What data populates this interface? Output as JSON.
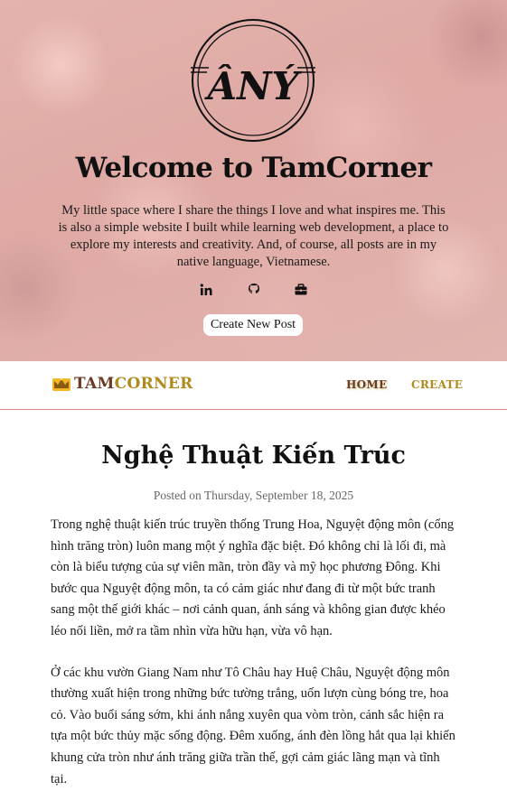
{
  "hero": {
    "logo_text": "ÂNÝ",
    "title": "Welcome to TamCorner",
    "description": "My little space where I share the things I love and what inspires me. This is also a simple website I built while learning web development, a place to explore my interests and creativity. And, of course, all posts are in my native language, Vietnamese.",
    "socials": [
      {
        "icon": "linkedin-icon"
      },
      {
        "icon": "github-icon"
      },
      {
        "icon": "briefcase-icon"
      }
    ],
    "create_button": "Create New Post"
  },
  "nav": {
    "brand_icon": "crown-icon",
    "brand_part1": "TAM",
    "brand_part2": "CORNER",
    "links": [
      {
        "label": "HOME"
      },
      {
        "label": "CREATE"
      }
    ]
  },
  "post": {
    "title": "Nghệ Thuật Kiến Trúc",
    "meta": "Posted on Thursday, September 18, 2025",
    "paragraphs": [
      "Trong nghệ thuật kiến trúc truyền thống Trung Hoa, Nguyệt động môn (cổng hình trăng tròn) luôn mang một ý nghĩa đặc biệt. Đó không chỉ là lối đi, mà còn là biểu tượng của sự viên mãn, tròn đầy và mỹ học phương Đông. Khi bước qua Nguyệt động môn, ta có cảm giác như đang đi từ một bức tranh sang một thế giới khác – nơi cảnh quan, ánh sáng và không gian được khéo léo nối liền, mở ra tầm nhìn vừa hữu hạn, vừa vô hạn.",
      "Ở các khu vườn Giang Nam như Tô Châu hay Huệ Châu, Nguyệt động môn thường xuất hiện trong những bức tường trắng, uốn lượn cùng bóng tre, hoa cỏ. Vào buổi sáng sớm, khi ánh nắng xuyên qua vòm tròn, cảnh sắc hiện ra tựa một bức thủy mặc sống động. Đêm xuống, ánh đèn lồng hắt qua lại khiến khung cửa tròn như ánh trăng giữa trần thế, gợi cảm giác lãng mạn và tĩnh tại."
    ]
  },
  "colors": {
    "brand_dark": "#6b3a22",
    "brand_gold": "#b08a1e",
    "divider": "#d98a8a",
    "hero_bg": "#e0aca7"
  }
}
